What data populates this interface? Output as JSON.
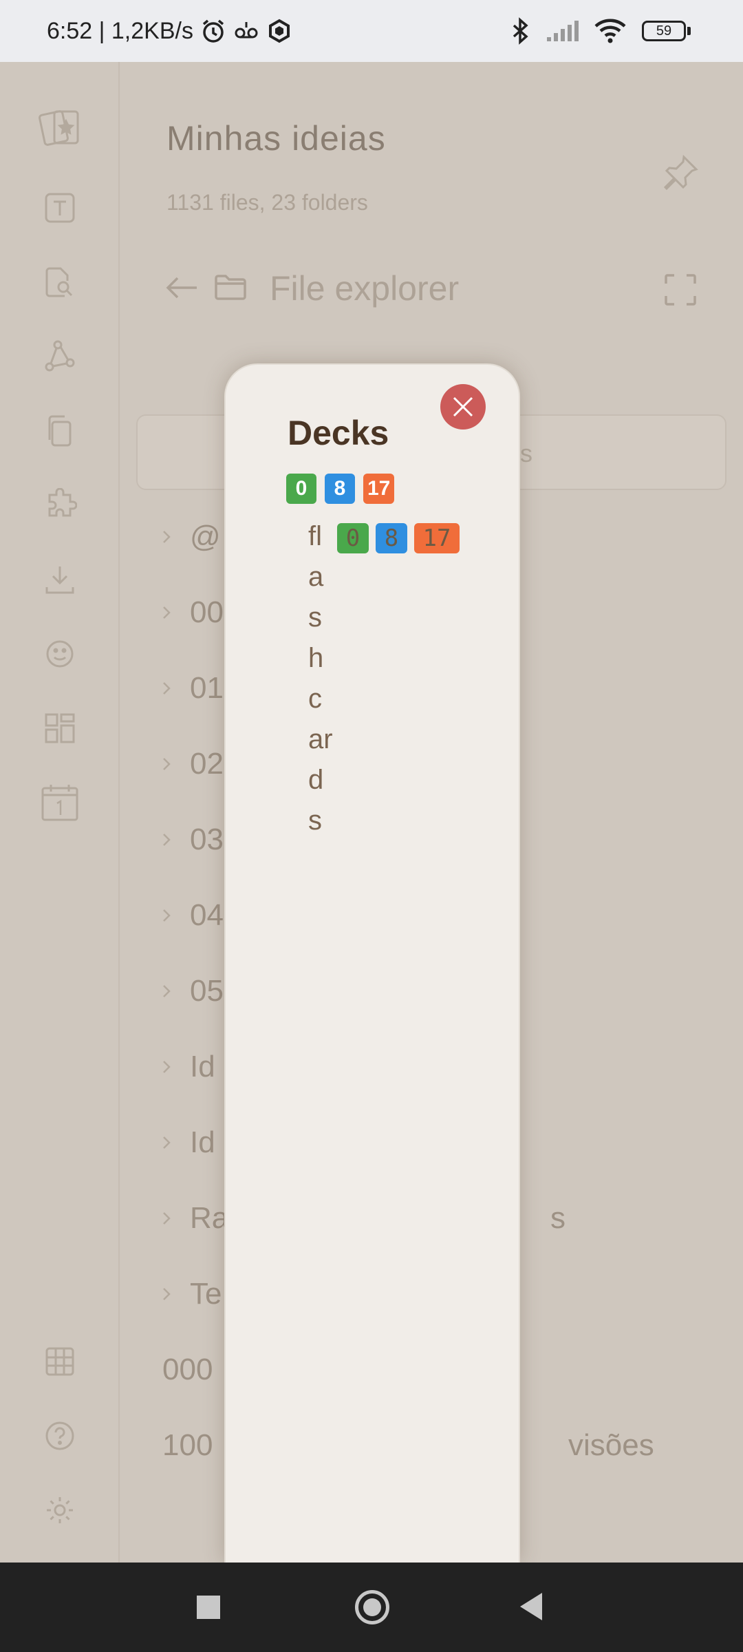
{
  "status_bar": {
    "time_speed": "6:52 | 1,2KB/s",
    "battery": "59"
  },
  "vault": {
    "title": "Minhas ideias",
    "stats": "1131 files, 23 folders"
  },
  "file_explorer": {
    "title": "File explorer",
    "search_placeholder_fragment": "s"
  },
  "tree": {
    "folders": [
      "@",
      "00",
      "01",
      "02",
      "03",
      "04",
      "05",
      "Id",
      "Id",
      "Ra",
      "Te"
    ],
    "raw_row_suffix": "s",
    "files": [
      "000",
      "100"
    ],
    "file_suffix": "visões"
  },
  "modal": {
    "title": "Decks",
    "totals": {
      "new": "0",
      "learning": "8",
      "due": "17"
    },
    "deck": {
      "name": "flashcards",
      "new": "0",
      "learning": "8",
      "due": "17"
    }
  },
  "colors": {
    "badge_new": "#4aa84b",
    "badge_learning": "#2f8fe0",
    "badge_due": "#f06d3a",
    "close_button": "#cc5b59"
  }
}
